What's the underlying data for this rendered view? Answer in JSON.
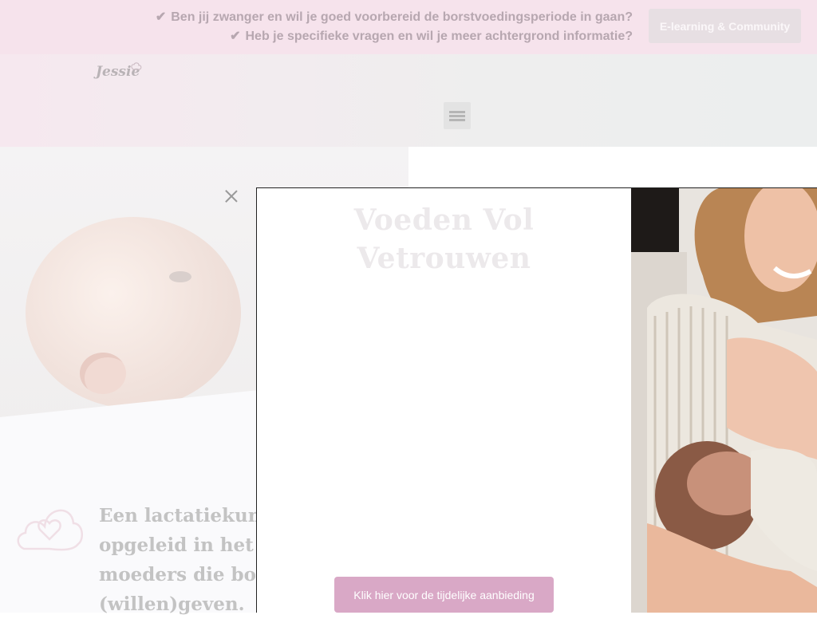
{
  "topbar": {
    "line1": "Ben jij zwanger en wil je goed voorbereid de borstvoedingsperiode in gaan?",
    "line2": "Heb je specifieke vragen en wil je meer achtergrond informatie?",
    "cta_label": "E-learning & Community"
  },
  "header": {
    "logo_text": "Jessie",
    "menu_icon": "hamburger-icon"
  },
  "intro": {
    "lines": [
      "Een lactatiekund",
      "opgeleid in het be",
      "moeders die borst",
      "(willen)geven."
    ]
  },
  "popup": {
    "title_line1": "Voeden Vol",
    "title_line2": "Vetrouwen",
    "cta_label": "Klik hier voor de tijdelijke aanbieding",
    "close_icon": "close-icon"
  },
  "colors": {
    "brand_pink": "#d9a8c6",
    "topbar_bg": "#f6e3ec"
  }
}
